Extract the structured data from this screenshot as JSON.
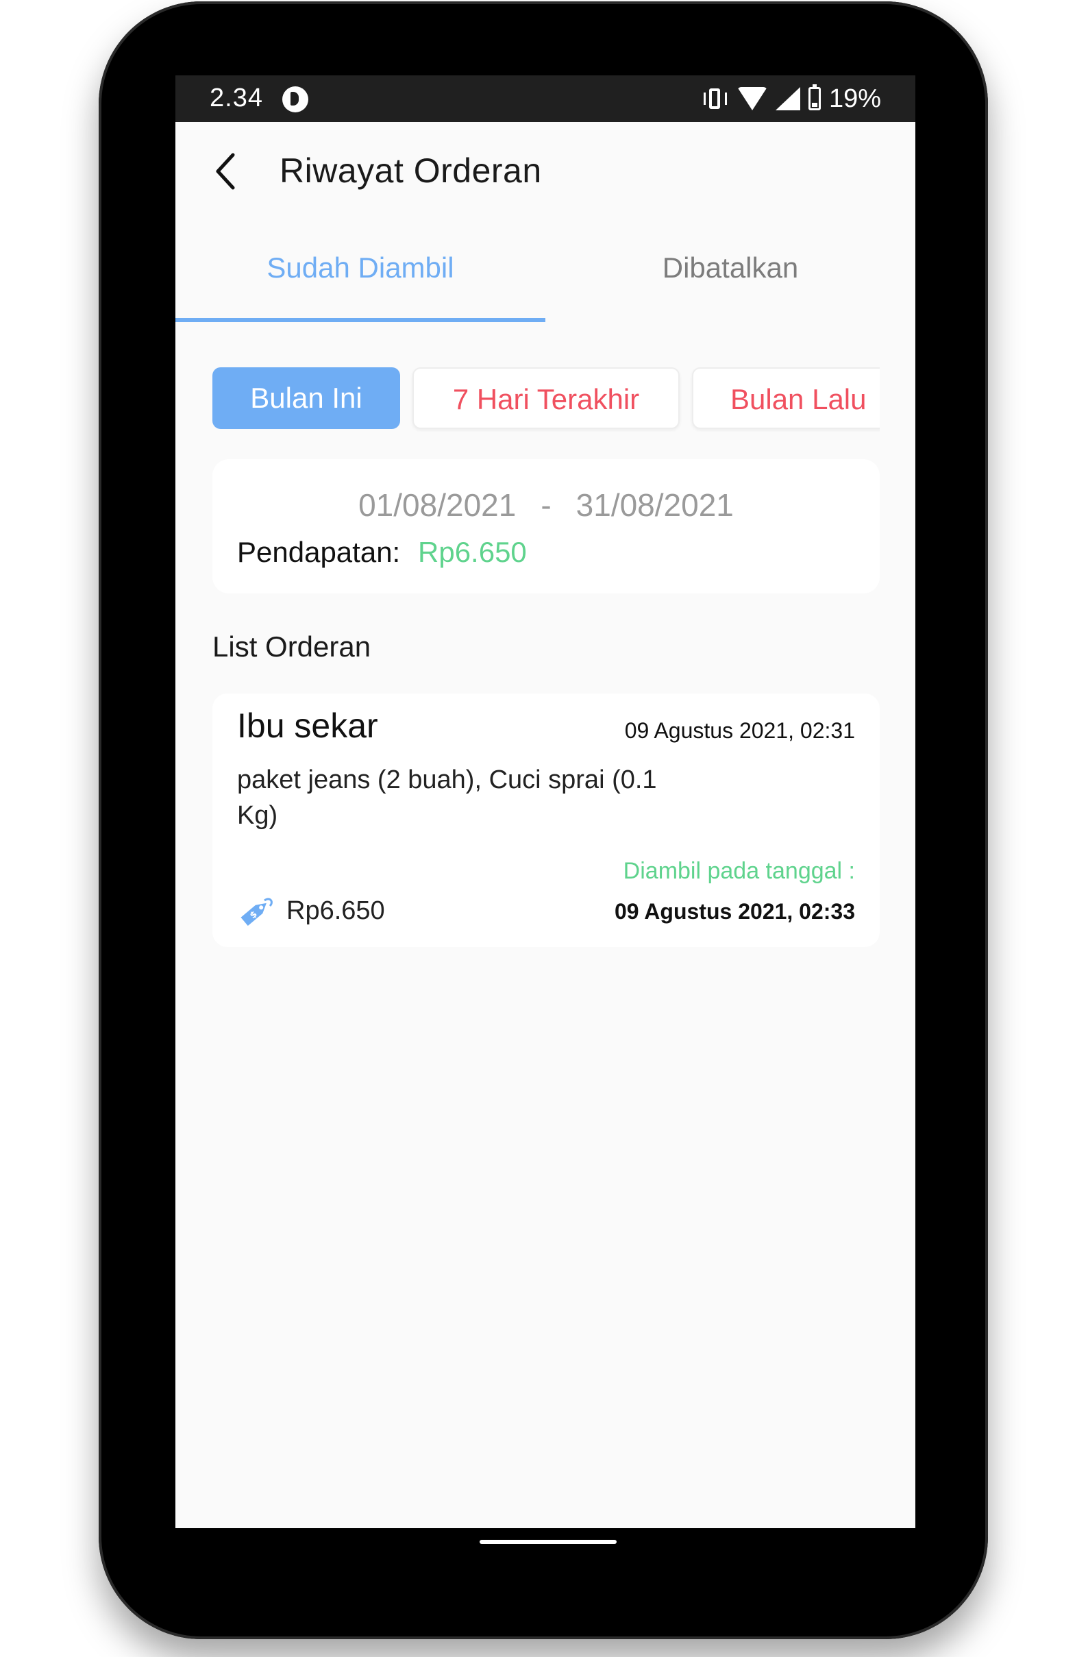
{
  "status_bar": {
    "time": "2.34",
    "battery": "19%"
  },
  "header": {
    "title": "Riwayat Orderan"
  },
  "tabs": [
    {
      "label": "Sudah Diambil",
      "active": true
    },
    {
      "label": "Dibatalkan",
      "active": false
    }
  ],
  "filters": [
    {
      "label": "Bulan Ini",
      "active": true
    },
    {
      "label": "7 Hari Terakhir",
      "active": false
    },
    {
      "label": "Bulan Lalu",
      "active": false
    }
  ],
  "summary": {
    "date_from": "01/08/2021",
    "separator": "-",
    "date_to": "31/08/2021",
    "income_label": "Pendapatan:",
    "income_value": "Rp6.650"
  },
  "list_title": "List Orderan",
  "orders": [
    {
      "customer": "Ibu sekar",
      "date": "09 Agustus 2021, 02:31",
      "items": "paket jeans (2 buah), Cuci sprai (0.1 Kg)",
      "price": "Rp6.650",
      "taken_label": "Diambil pada tanggal :",
      "taken_date": "09 Agustus 2021, 02:33"
    }
  ],
  "colors": {
    "accent_blue": "#6fadf4",
    "accent_red": "#f0505f",
    "accent_green": "#5fd38d",
    "status_bar": "#202020"
  },
  "icons": {
    "back": "chevron-left-icon",
    "price": "price-tag-icon",
    "status": [
      "app-notification-icon",
      "vibrate-icon",
      "wifi-icon",
      "signal-icon",
      "battery-charging-icon"
    ]
  }
}
